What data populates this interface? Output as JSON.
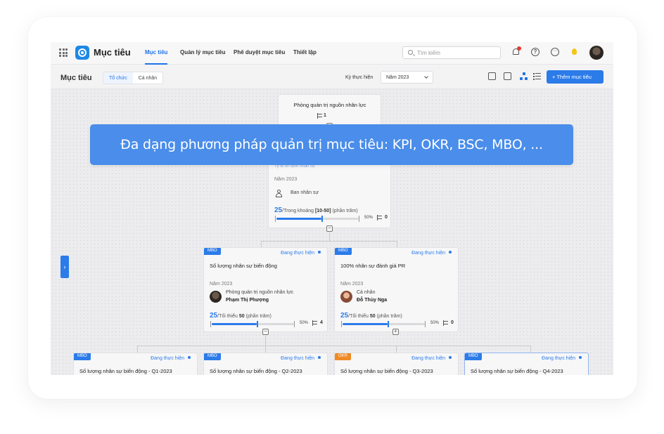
{
  "header": {
    "app_title": "Mục tiêu",
    "nav": [
      "Mục tiêu",
      "Quản lý mục tiêu",
      "Phê duyệt mục tiêu",
      "Thiết lập"
    ],
    "search_placeholder": "Tìm kiếm"
  },
  "subbar": {
    "page_title": "Mục tiêu",
    "segments": [
      "Tổ chức",
      "Cá nhân"
    ],
    "period_label": "Kỳ thực hiện",
    "period_value": "Năm 2023",
    "add_button": "+ Thêm mục tiêu"
  },
  "banner": "Đa dạng phương pháp quản trị mục tiêu: KPI, OKR, BSC, MBO, ...",
  "root_card": {
    "title": "Phòng quản trị nguồn nhân lực",
    "count": "1"
  },
  "mid_card": {
    "subtitle": "Tỷ lệ ổn định nhân sự",
    "year": "Năm 2023",
    "owner": "Ban nhân sự",
    "metric_value": "25",
    "metric_text": "/Trong khoảng ",
    "metric_bold": "[10-50]",
    "metric_unit": " (phần trăm)",
    "progress_fraction": 0.55,
    "pct": "50%",
    "count": "0"
  },
  "level2": [
    {
      "tag": "MBO",
      "status": "Đang thực hiện",
      "title": "Số lượng nhân sự biến động",
      "year": "Năm 2023",
      "owner_l1": "Phòng quản trị nguồn nhân lực",
      "owner_l2": "Phạm Thị Phượng",
      "metric_value": "25",
      "metric_text": "/Tối thiểu ",
      "metric_bold": "50",
      "metric_unit": " (phần trăm)",
      "progress_fraction": 0.55,
      "pct": "50%",
      "count": "4",
      "toggle": "−"
    },
    {
      "tag": "MBO",
      "status": "Đang thực hiện",
      "title": "100% nhân sự đánh giá PR",
      "year": "Năm 2023",
      "owner_l1": "Cá nhân",
      "owner_l2": "Đỗ Thùy Nga",
      "metric_value": "25",
      "metric_text": "/Tối thiểu ",
      "metric_bold": "50",
      "metric_unit": " (phần trăm)",
      "progress_fraction": 0.55,
      "pct": "50%",
      "count": "0",
      "toggle": "+"
    }
  ],
  "level3": [
    {
      "tag": "MBO",
      "status": "Đang thực hiện",
      "title": "Số lượng nhân sự biến động - Q1-2023"
    },
    {
      "tag": "MBO",
      "status": "Đang thực hiện",
      "title": "Số lượng nhân sự biến động - Q2-2023"
    },
    {
      "tag": "OKR",
      "status": "Đang thực hiện",
      "title": "Số lượng nhân sự biến động - Q3-2023"
    },
    {
      "tag": "MBO",
      "status": "Đang thực hiện",
      "title": "Số lượng nhân sự biến động - Q4-2023"
    }
  ],
  "colors": {
    "accent": "#2b7be9",
    "okr_tag": "#f08a24",
    "banner": "#4a8dea"
  }
}
